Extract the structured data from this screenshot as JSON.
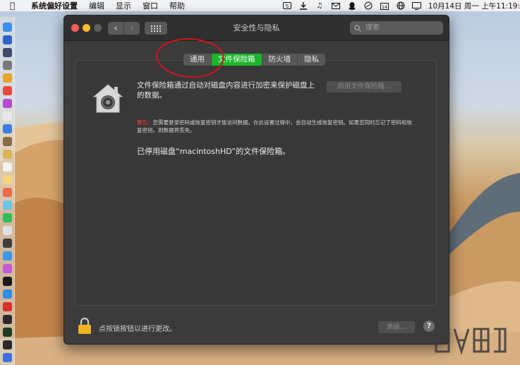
{
  "menubar": {
    "app_name": "系统偏好设置",
    "items": [
      "编辑",
      "显示",
      "窗口",
      "帮助"
    ],
    "clock": "10月14日 周一 上午11:19:",
    "status_icons": [
      "sogou-icon",
      "download-icon",
      "music-icon",
      "mail-icon",
      "qq-icon",
      "wifi-speed-icon",
      "calendar-icon",
      "globe-icon",
      "display-icon"
    ]
  },
  "window": {
    "title": "安全性与隐私",
    "search_placeholder": "搜索",
    "tabs": [
      {
        "label": "通用",
        "active": false
      },
      {
        "label": "文件保险箱",
        "active": true
      },
      {
        "label": "防火墙",
        "active": false
      },
      {
        "label": "隐私",
        "active": false
      }
    ],
    "description": "文件保险箱通过自动对磁盘内容进行加密来保护磁盘上的数据。",
    "enable_button": "启用文件保险箱...",
    "warning_label": "警告：",
    "warning_text": "您需要登录密码或恢复密钥才能访问数据。在此设置过程中，会自动生成恢复密钥。如果您同时忘记了密码和恢复密钥，则数据将丢失。",
    "status": "已停用磁盘“macintoshHD”的文件保险箱。",
    "lock_text": "点按锁按钮以进行更改。",
    "advanced_button": "高级...",
    "help_button": "?"
  },
  "colors": {
    "active_tab": "#1ab629",
    "warning": "#ff3b30",
    "annotation": "#c4171f"
  }
}
